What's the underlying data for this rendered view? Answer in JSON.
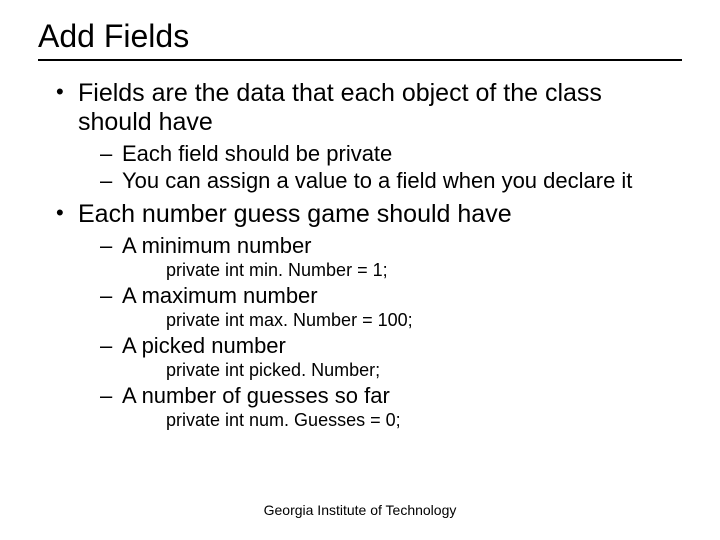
{
  "title": "Add Fields",
  "bullets": {
    "b1": "Fields are the data that each object of the class should have",
    "b1_subs": {
      "s1": "Each field should be private",
      "s2": "You can assign a value to a field when you declare it"
    },
    "b2": "Each number guess game should have",
    "b2_subs": {
      "s1": "A minimum number",
      "c1": "private int min. Number = 1;",
      "s2": "A maximum number",
      "c2": "private int max. Number = 100;",
      "s3": "A picked number",
      "c3": "private int picked. Number;",
      "s4": "A number of guesses so far",
      "c4": "private int num. Guesses = 0;"
    }
  },
  "footer": "Georgia Institute of Technology"
}
